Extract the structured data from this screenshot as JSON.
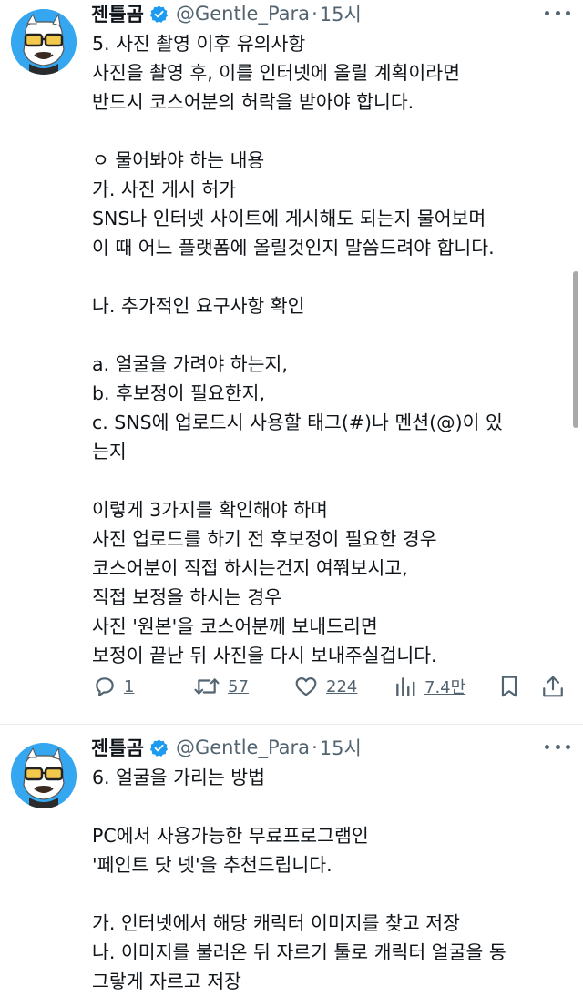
{
  "tweets": [
    {
      "author": {
        "name": "젠틀곰",
        "handle": "@Gentle_Para",
        "separator": "·",
        "time": "15시"
      },
      "lines": [
        "5. 사진 촬영 이후 유의사항",
        "사진을 촬영 후, 이를 인터넷에 올릴 계획이라면",
        "반드시 코스어분의 허락을 받아야 합니다.",
        "",
        "ㅇ 물어봐야 하는 내용",
        "가. 사진 게시 허가",
        "SNS나 인터넷 사이트에 게시해도 되는지 물어보며",
        "이 때 어느 플랫폼에 올릴것인지 말씀드려야 합니다.",
        "",
        "나. 추가적인 요구사항 확인",
        "",
        "a. 얼굴을 가려야 하는지,",
        "b. 후보정이 필요한지,",
        "c. SNS에 업로드시 사용할 태그(#)나 멘션(@)이 있",
        "는지",
        "",
        "이렇게 3가지를 확인해야 하며",
        "사진 업로드를 하기 전 후보정이 필요한 경우",
        "코스어분이 직접 하시는건지 여쭤보시고,",
        "직접 보정을 하시는 경우",
        "사진 '원본'을 코스어분께 보내드리면",
        "보정이 끝난 뒤 사진을 다시 보내주실겁니다."
      ],
      "actions": {
        "replies": "1",
        "retweets": "57",
        "likes": "224",
        "views": "7.4만"
      }
    },
    {
      "author": {
        "name": "젠틀곰",
        "handle": "@Gentle_Para",
        "separator": "·",
        "time": "15시"
      },
      "lines": [
        "6. 얼굴을 가리는 방법",
        "",
        "PC에서 사용가능한 무료프로그램인",
        "'페인트 닷 넷'을 추천드립니다.",
        "",
        "가. 인터넷에서 해당 캐릭터 이미지를 찾고 저장",
        "나. 이미지를 불러온 뒤 자르기 툴로 캐릭터 얼굴을 동",
        "그랗게 자르고 저장"
      ]
    }
  ],
  "icons": {
    "verified": "verified-badge-icon",
    "reply": "reply-icon",
    "retweet": "retweet-icon",
    "like": "heart-icon",
    "views": "views-icon",
    "bookmark": "bookmark-icon",
    "share": "share-icon",
    "more": "more-icon"
  },
  "colors": {
    "verified": "#1d9bf0",
    "muted": "#536471",
    "text": "#0f1419",
    "avatar_bg": "#35a7f0"
  }
}
